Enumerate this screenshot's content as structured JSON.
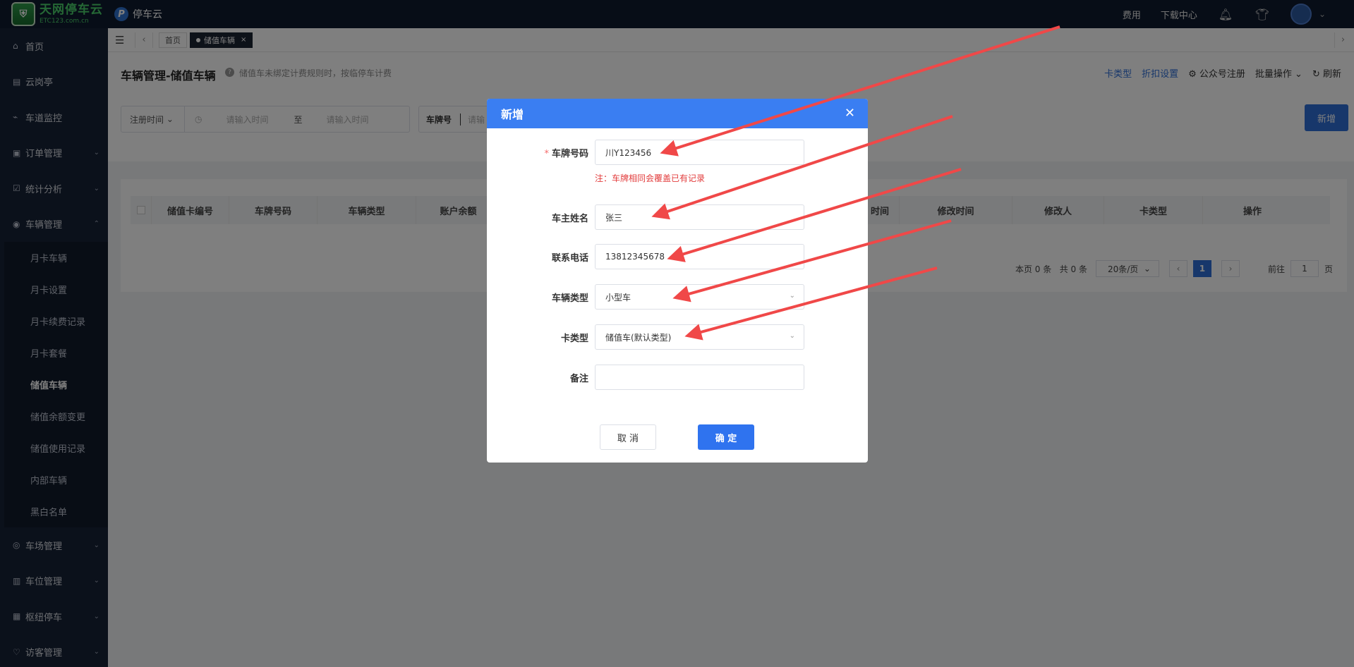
{
  "topbar": {
    "logo_text": "天网停车云",
    "logo_sub": "ETC123.com.cn",
    "brand_icon": "P",
    "brand_name": "停车云",
    "links": [
      "费用",
      "下载中心"
    ],
    "icons": [
      "bell-icon",
      "shirt-icon"
    ]
  },
  "sidebar": {
    "items": [
      {
        "label": "首页",
        "icon": "⌂"
      },
      {
        "label": "云岗亭",
        "icon": "▤"
      },
      {
        "label": "车道监控",
        "icon": "⌁"
      },
      {
        "label": "订单管理",
        "icon": "▣"
      },
      {
        "label": "统计分析",
        "icon": "☑"
      },
      {
        "label": "车辆管理",
        "icon": "◉"
      }
    ],
    "subitems": [
      "月卡车辆",
      "月卡设置",
      "月卡续费记录",
      "月卡套餐",
      "储值车辆",
      "储值余额变更",
      "储值使用记录",
      "内部车辆",
      "黑白名单"
    ],
    "active_sub": "储值车辆",
    "bottom_items": [
      {
        "label": "车场管理",
        "icon": "◎"
      },
      {
        "label": "车位管理",
        "icon": "▥"
      },
      {
        "label": "枢纽停车",
        "icon": "▦"
      },
      {
        "label": "访客管理",
        "icon": "♡"
      }
    ]
  },
  "tabs": {
    "home": "首页",
    "active": "储值车辆",
    "close": "×"
  },
  "page": {
    "title": "车辆管理-储值车辆",
    "hint": "储值车未绑定计费规则时，按临停车计费",
    "actions": {
      "card_type": "卡类型",
      "discount": "折扣设置",
      "wechat": "公众号注册",
      "batch": "批量操作",
      "refresh": "刷新"
    },
    "filter": {
      "time_select": "注册时间",
      "start_placeholder": "请输入时间",
      "to": "至",
      "end_placeholder": "请输入时间",
      "plate_label": "车牌号",
      "plate_placeholder": "请输"
    },
    "add_button": "新增"
  },
  "table": {
    "columns": [
      "储值卡编号",
      "车牌号码",
      "车辆类型",
      "账户余额",
      "",
      "",
      "",
      "",
      "",
      "时间",
      "修改时间",
      "修改人",
      "卡类型",
      "操作"
    ]
  },
  "pager": {
    "this_page": "本页 0 条",
    "total": "共 0 条",
    "page_size": "20条/页",
    "current": "1",
    "goto_prefix": "前往",
    "goto_value": "1",
    "goto_suffix": "页"
  },
  "dialog": {
    "title": "新增",
    "close": "✕",
    "fields": {
      "plate": {
        "label": "车牌号码",
        "value": "川Y123456",
        "required": "*"
      },
      "note": "注：车牌相同会覆盖已有记录",
      "owner": {
        "label": "车主姓名",
        "value": "张三"
      },
      "phone": {
        "label": "联系电话",
        "value": "13812345678"
      },
      "vehicle_type": {
        "label": "车辆类型",
        "value": "小型车"
      },
      "card_type": {
        "label": "卡类型",
        "value": "储值车(默认类型)"
      },
      "remark": {
        "label": "备注",
        "value": ""
      }
    },
    "cancel": "取 消",
    "confirm": "确 定"
  },
  "colors": {
    "primary": "#2f6ed6",
    "dialog_header": "#3a7ef2",
    "annotation_arrow": "#f04848",
    "sidebar_bg": "#172237"
  }
}
